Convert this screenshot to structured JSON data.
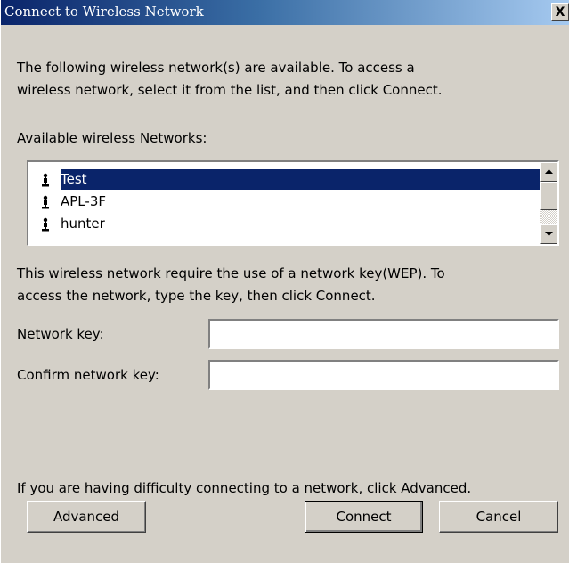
{
  "window": {
    "title": "Connect to Wireless Network",
    "close_glyph": "X"
  },
  "intro": {
    "line1": "The following wireless network(s) are available. To access a",
    "line2": "wireless network, select it from the list, and then click Connect."
  },
  "networks": {
    "label": "Available wireless Networks:",
    "items": [
      {
        "name": "Test",
        "selected": true
      },
      {
        "name": "APL-3F",
        "selected": false
      },
      {
        "name": "hunter",
        "selected": false
      }
    ],
    "icon": "antenna-icon"
  },
  "wep": {
    "line1": "This wireless network require the use of a network key(WEP). To",
    "line2": "access the network, type the key, then click Connect."
  },
  "fields": {
    "network_key_label": "Network key:",
    "network_key_value": "",
    "confirm_key_label": "Confirm network key:",
    "confirm_key_value": ""
  },
  "help_text": "If you are having difficulty connecting to a network, click Advanced.",
  "buttons": {
    "advanced": "Advanced",
    "connect": "Connect",
    "cancel": "Cancel"
  },
  "colors": {
    "dialog_bg": "#d4d0c8",
    "title_gradient_start": "#0a246a",
    "title_gradient_end": "#a6caf0",
    "selection": "#0a246a"
  }
}
